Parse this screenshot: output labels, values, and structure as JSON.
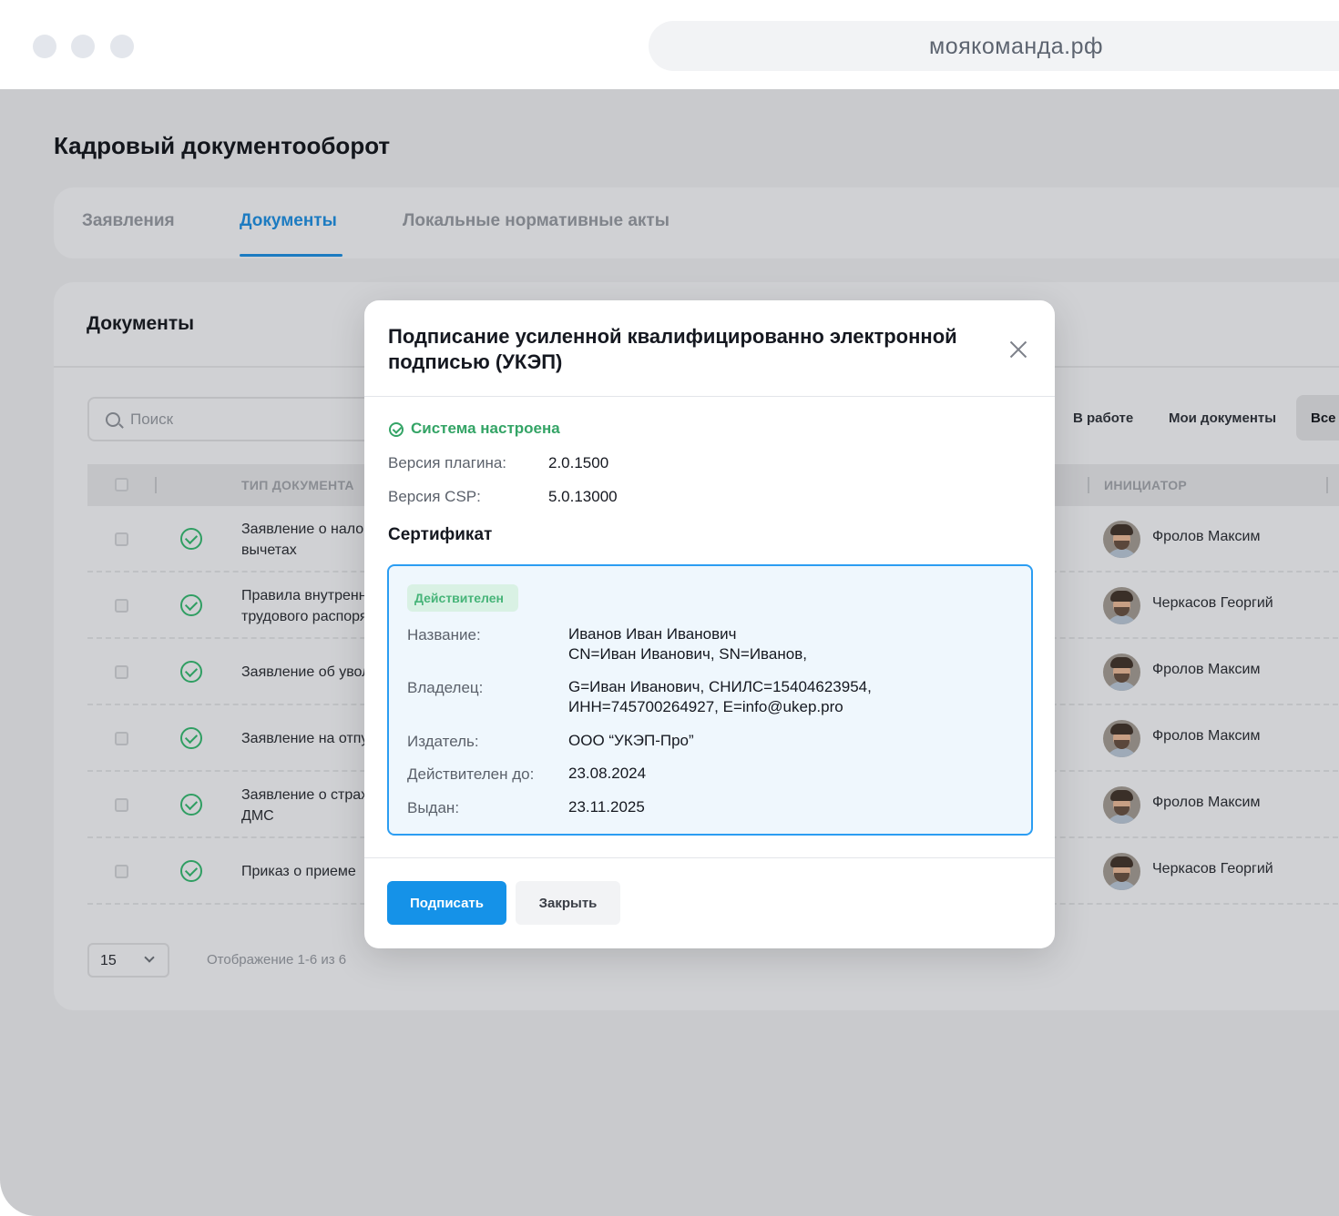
{
  "browser": {
    "url": "моякоманда.рф"
  },
  "page": {
    "title": "Кадровый документооборот",
    "tabs": [
      {
        "label": "Заявления"
      },
      {
        "label": "Документы"
      },
      {
        "label": "Локальные нормативные акты"
      }
    ],
    "active_tab": "Документы"
  },
  "documents": {
    "title": "Документы",
    "search_placeholder": "Поиск",
    "filters": [
      "В работе",
      "Мои документы",
      "Все д"
    ],
    "columns": {
      "doc_type": "ТИП ДОКУМЕНТА",
      "initiator": "ИНИЦИАТОР"
    },
    "rows": [
      {
        "doc_line1": "Заявление о налоговых",
        "doc_line2": "вычетах",
        "initiator": "Фролов Максим"
      },
      {
        "doc_line1": "Правила внутреннего",
        "doc_line2": "трудового распорядка",
        "initiator": "Черкасов Георгий"
      },
      {
        "doc_line1": "Заявление об увольнении",
        "doc_line2": "",
        "initiator": "Фролов Максим"
      },
      {
        "doc_line1": "Заявление на отпуск",
        "doc_line2": "",
        "initiator": "Фролов Максим"
      },
      {
        "doc_line1": "Заявление о страховании",
        "doc_line2": "ДМС",
        "initiator": "Фролов Максим"
      },
      {
        "doc_line1": "Приказ о приеме",
        "doc_line2": "",
        "initiator": "Черкасов Георгий"
      }
    ],
    "page_size": "15",
    "pagination_info": "Отображение 1-6 из 6"
  },
  "modal": {
    "title": "Подписание усиленной квалифицированно электронной подписью (УКЭП)",
    "status": "Система настроена",
    "plugin_label": "Версия плагина:",
    "plugin_value": "2.0.1500",
    "csp_label": "Версия CSP:",
    "csp_value": "5.0.13000",
    "certificate_heading": "Сертификат",
    "certificate": {
      "badge": "Действителен",
      "name_label": "Название:",
      "name_line1": "Иванов Иван Иванович",
      "name_line2": "CN=Иван Иванович, SN=Иванов,",
      "owner_label": "Владелец:",
      "owner_line1": "G=Иван Иванович, СНИЛС=15404623954,",
      "owner_line2": "ИНН=745700264927, E=info@ukep.pro",
      "issuer_label": "Издатель:",
      "issuer_value": "ООО “УКЭП-Про”",
      "valid_until_label": "Действителен до:",
      "valid_until_value": "23.08.2024",
      "issued_label": "Выдан:",
      "issued_value": "23.11.2025"
    },
    "sign_button": "Подписать",
    "close_button": "Закрыть"
  },
  "colors": {
    "accent": "#1592e8",
    "active_tab": "#1c7bc1",
    "success": "#34a466",
    "certificate_border": "#2b9df2"
  },
  "icons": [
    "search-icon",
    "close-icon",
    "check-circle-icon",
    "chevron-down-icon"
  ]
}
